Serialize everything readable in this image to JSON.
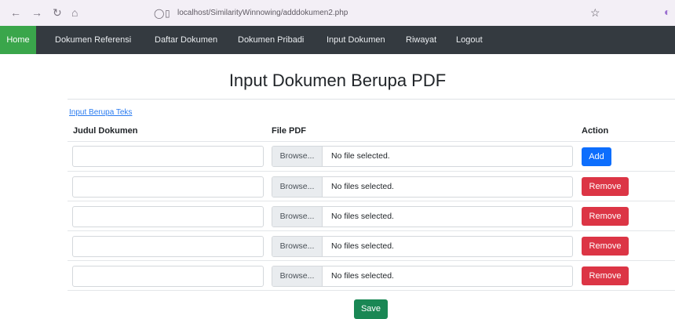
{
  "browser": {
    "url": "localhost/SimilarityWinnowing/adddokumen2.php",
    "back_icon": "arrow-left",
    "forward_icon": "arrow-right",
    "reload_icon": "reload",
    "home_icon": "home",
    "star_icon": "star"
  },
  "navbar": {
    "items": [
      "Home",
      "Dokumen Referensi",
      "Daftar Dokumen",
      "Dokumen Pribadi",
      "Input Dokumen",
      "Riwayat",
      "Logout"
    ],
    "active_color": "#3aa64b",
    "bg_color": "#343a40"
  },
  "page": {
    "title": "Input Dokumen Berupa PDF",
    "link_text": "Input Berupa Teks"
  },
  "table": {
    "headers": {
      "judul": "Judul Dokumen",
      "file": "File PDF",
      "action": "Action"
    },
    "rows": [
      {
        "browse": "Browse...",
        "status": "No file selected.",
        "action": "Add"
      },
      {
        "browse": "Browse...",
        "status": "No files selected.",
        "action": "Remove"
      },
      {
        "browse": "Browse...",
        "status": "No files selected.",
        "action": "Remove"
      },
      {
        "browse": "Browse...",
        "status": "No files selected.",
        "action": "Remove"
      },
      {
        "browse": "Browse...",
        "status": "No files selected.",
        "action": "Remove"
      }
    ]
  },
  "save_label": "Save",
  "colors": {
    "add": "#0d6efd",
    "remove": "#dc3545",
    "save": "#198754"
  }
}
